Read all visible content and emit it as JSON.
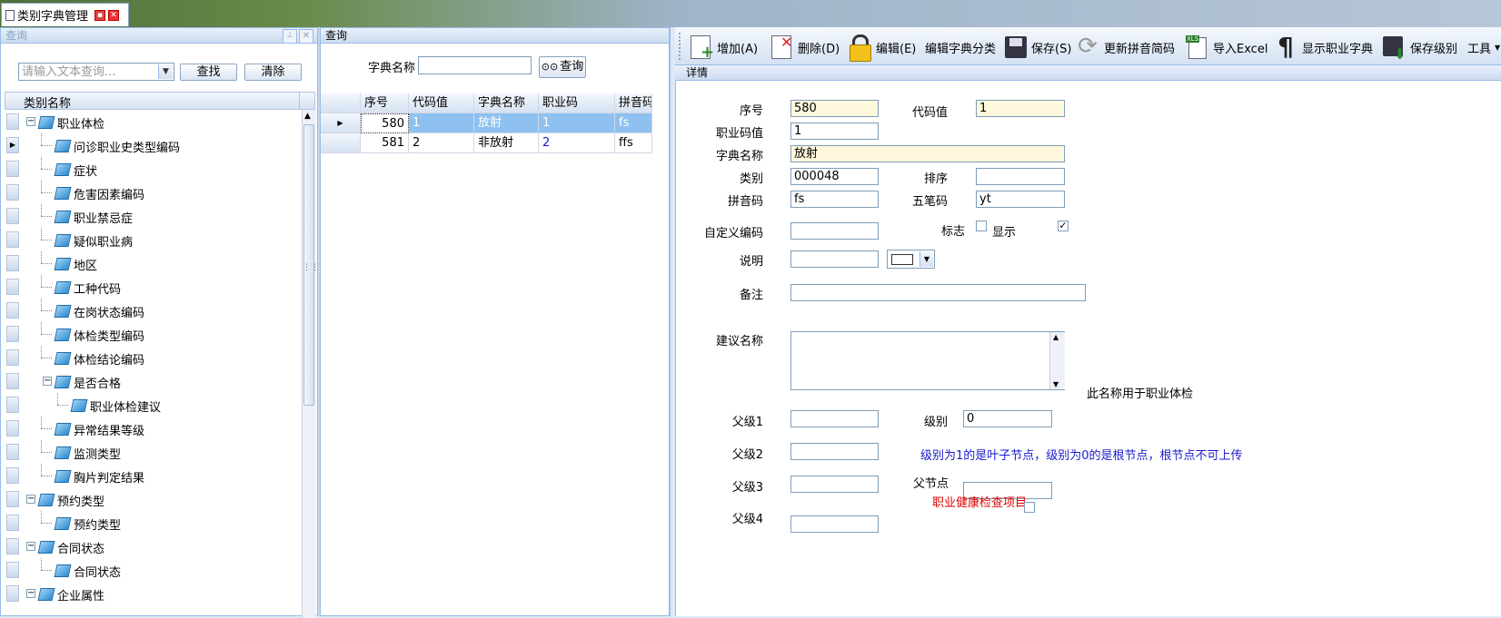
{
  "window": {
    "tab_title": "类别字典管理"
  },
  "left": {
    "header": "查询",
    "search_placeholder": "请输入文本查询...",
    "find_label": "查找",
    "clear_label": "清除",
    "column_header": "类别名称",
    "tree": [
      {
        "label": "职业体检",
        "level": 0,
        "expanded": true
      },
      {
        "label": "问诊职业史类型编码",
        "level": 1
      },
      {
        "label": "症状",
        "level": 1
      },
      {
        "label": "危害因素编码",
        "level": 1
      },
      {
        "label": "职业禁忌症",
        "level": 1
      },
      {
        "label": "疑似职业病",
        "level": 1
      },
      {
        "label": "地区",
        "level": 1
      },
      {
        "label": "工种代码",
        "level": 1
      },
      {
        "label": "在岗状态编码",
        "level": 1
      },
      {
        "label": "体检类型编码",
        "level": 1
      },
      {
        "label": "体检结论编码",
        "level": 1
      },
      {
        "label": "是否合格",
        "level": 1,
        "expanded": true
      },
      {
        "label": "职业体检建议",
        "level": 2
      },
      {
        "label": "异常结果等级",
        "level": 1
      },
      {
        "label": "监测类型",
        "level": 1
      },
      {
        "label": "胸片判定结果",
        "level": 1
      },
      {
        "label": "预约类型",
        "level": 0,
        "expanded": true
      },
      {
        "label": "预约类型",
        "level": 1
      },
      {
        "label": "合同状态",
        "level": 0,
        "expanded": true
      },
      {
        "label": "合同状态",
        "level": 1
      },
      {
        "label": "企业属性",
        "level": 0,
        "expanded": true
      }
    ]
  },
  "middle": {
    "header": "查询",
    "dict_name_label": "字典名称",
    "dict_name_value": "",
    "query_label": "查询",
    "columns": [
      "序号",
      "代码值",
      "字典名称",
      "职业码",
      "拼音码"
    ],
    "rows": [
      [
        "580",
        "1",
        "放射",
        "1",
        "fs"
      ],
      [
        "581",
        "2",
        "非放射",
        "2",
        "ffs"
      ]
    ]
  },
  "toolbar": {
    "add": "增加(A)",
    "delete": "删除(D)",
    "edit": "编辑(E)",
    "edit_category": "编辑字典分类",
    "save": "保存(S)",
    "update_pinyin": "更新拼音简码",
    "import_excel": "导入Excel",
    "show_occ_dict": "显示职业字典",
    "save_level": "保存级别",
    "tools": "工具"
  },
  "detail": {
    "header": "详情",
    "labels": {
      "seq": "序号",
      "code_value": "代码值",
      "occ_code": "职业码值",
      "dict_name": "字典名称",
      "category": "类别",
      "order": "排序",
      "pinyin": "拼音码",
      "wubi": "五笔码",
      "custom_code": "自定义编码",
      "flag": "标志",
      "display": "显示",
      "desc": "说明",
      "remark": "备注",
      "suggest_name": "建议名称",
      "parent1": "父级1",
      "level": "级别",
      "parent2": "父级2",
      "parent3": "父级3",
      "parent_node": "父节点",
      "parent4": "父级4",
      "occ_health_item": "职业健康检查项目"
    },
    "values": {
      "seq": "580",
      "code_value": "1",
      "occ_code": "1",
      "dict_name": "放射",
      "category": "000048",
      "order": "",
      "pinyin": "fs",
      "wubi": "yt",
      "custom_code": "",
      "desc": "",
      "remark": "",
      "suggest_name": "",
      "parent1": "",
      "level": "0",
      "parent2": "",
      "parent3": "",
      "parent_node": "",
      "parent4": "",
      "display_checked": "✓"
    },
    "note_occ": "此名称用于职业体检",
    "note_level": "级别为1的是叶子节点，级别为0的是根节点，根节点不可上传"
  }
}
